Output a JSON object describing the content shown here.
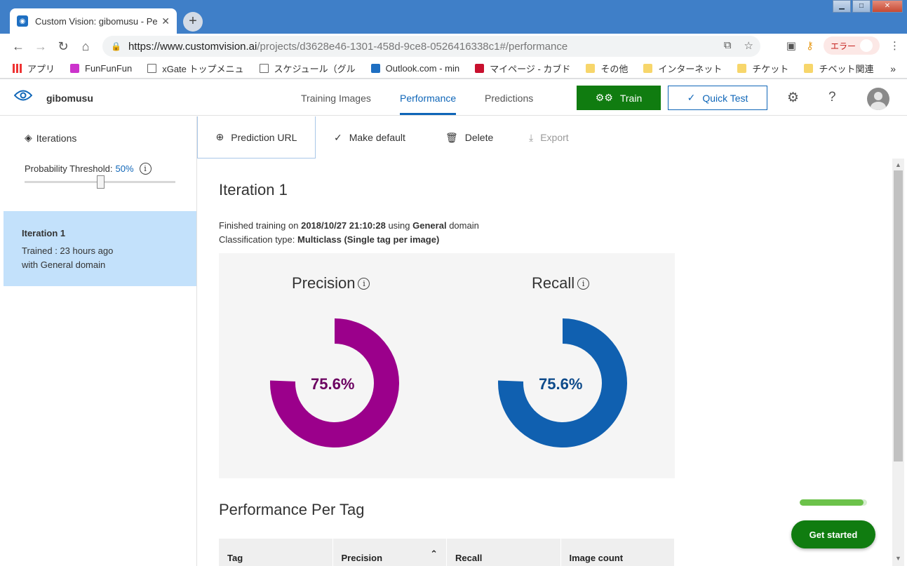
{
  "browser": {
    "tab_title": "Custom Vision: gibomusu - Pe",
    "url_host": "https://www.customvision.ai",
    "url_path": "/projects/d3628e46-1301-458d-9ce8-0526416338c1#/performance",
    "error_chip": "エラー",
    "bookmarks": [
      "アプリ",
      "FunFunFun",
      "xGate トップメニュ",
      "スケジュール（グル",
      "Outlook.com - min",
      "マイページ - カブド",
      "その他",
      "インターネット",
      "チケット",
      "チベット関連"
    ]
  },
  "header": {
    "project_name": "gibomusu",
    "tabs": [
      "Training Images",
      "Performance",
      "Predictions"
    ],
    "active_tab": "Performance",
    "train_label": "Train",
    "quick_test_label": "Quick Test"
  },
  "sidebar": {
    "iterations_label": "Iterations",
    "threshold_label": "Probability Threshold:",
    "threshold_value": "50%",
    "threshold_fraction": 0.5,
    "iteration": {
      "title": "Iteration 1",
      "trained": "Trained : 23 hours ago",
      "domain": "with General domain"
    }
  },
  "actions": {
    "prediction_url": "Prediction URL",
    "make_default": "Make default",
    "delete": "Delete",
    "export": "Export"
  },
  "main": {
    "title": "Iteration 1",
    "finished_prefix": "Finished training on",
    "finished_date": "2018/10/27 21:10:28",
    "using": "using",
    "domain": "General",
    "domain_suffix": "domain",
    "classification_prefix": "Classification type:",
    "classification_value": "Multiclass (Single tag per image)",
    "precision_label": "Precision",
    "recall_label": "Recall",
    "section_title": "Performance Per Tag",
    "table_headers": [
      "Tag",
      "Precision",
      "Recall",
      "Image count"
    ]
  },
  "chart_data": [
    {
      "type": "pie",
      "title": "Precision",
      "values": [
        75.6,
        24.4
      ],
      "display": "75.6%",
      "color": "#9b008b"
    },
    {
      "type": "pie",
      "title": "Recall",
      "values": [
        75.6,
        24.4
      ],
      "display": "75.6%",
      "color": "#1060b0"
    }
  ],
  "colors": {
    "accent": "#0f66b8",
    "train_green": "#107c10",
    "precision": "#9b008b",
    "recall": "#1060b0",
    "selected_item": "#c3e1fb"
  },
  "help": {
    "get_started": "Get started",
    "progress_fraction": 0.95
  }
}
